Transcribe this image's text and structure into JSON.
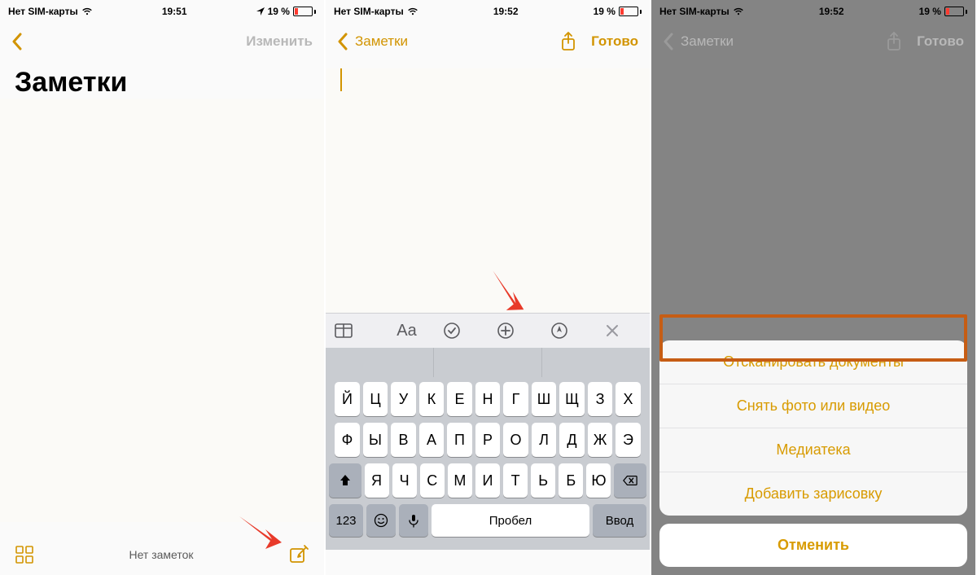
{
  "colors": {
    "accent": "#d29400",
    "arrow": "#e83a2a",
    "highlight": "#c65d14"
  },
  "panel1": {
    "status": {
      "carrier": "Нет SIM-карты",
      "time": "19:51",
      "battery_text": "19 %",
      "loc_icon": "location-icon",
      "wifi_icon": "wifi-icon"
    },
    "nav": {
      "edit": "Изменить"
    },
    "title": "Заметки",
    "bottom": {
      "empty_text": "Нет заметок"
    }
  },
  "panel2": {
    "status": {
      "carrier": "Нет SIM-карты",
      "time": "19:52",
      "battery_text": "19 %"
    },
    "nav": {
      "back": "Заметки",
      "done": "Готово"
    },
    "fmt_labels": {
      "aa": "Aa"
    },
    "keyboard": {
      "row1": [
        "Й",
        "Ц",
        "У",
        "К",
        "Е",
        "Н",
        "Г",
        "Ш",
        "Щ",
        "З",
        "Х"
      ],
      "row2": [
        "Ф",
        "Ы",
        "В",
        "А",
        "П",
        "Р",
        "О",
        "Л",
        "Д",
        "Ж",
        "Э"
      ],
      "row3": [
        "Я",
        "Ч",
        "С",
        "М",
        "И",
        "Т",
        "Ь",
        "Б",
        "Ю"
      ],
      "numkey": "123",
      "space": "Пробел",
      "enter": "Ввод"
    }
  },
  "panel3": {
    "status": {
      "carrier": "Нет SIM-карты",
      "time": "19:52",
      "battery_text": "19 %"
    },
    "nav": {
      "back": "Заметки",
      "done": "Готово"
    },
    "sheet": {
      "items": [
        "Отсканировать документы",
        "Снять фото или видео",
        "Медиатека",
        "Добавить зарисовку"
      ],
      "cancel": "Отменить"
    }
  }
}
